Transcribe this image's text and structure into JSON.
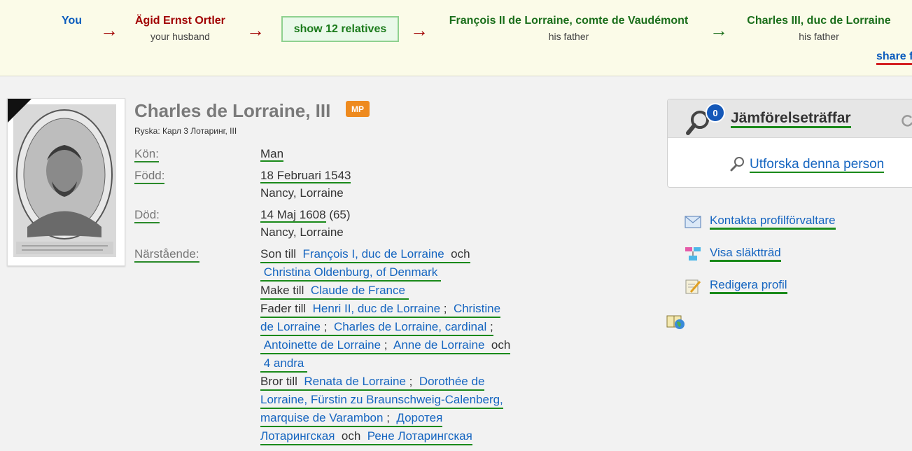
{
  "path": {
    "you": "You",
    "node1": {
      "name": "Ägid Ernst Ortler",
      "relation": "your husband"
    },
    "show_relatives": "show 12 relatives",
    "node2": {
      "name": "François II de Lorraine, comte de Vaudémont",
      "relation": "his father"
    },
    "node3": {
      "name": "Charles III, duc de Lorraine",
      "relation": "his father"
    },
    "share": "share f",
    "arrow": "→"
  },
  "profile": {
    "name": "Charles de Lorraine, III",
    "badge": "MP",
    "alt_name": "Ryska: Карл 3 Лотаринг, III",
    "gender_label": "Kön:",
    "gender": "Man",
    "born_label": "Född:",
    "born_date": "18 Februari 1543",
    "born_place": "Nancy, Lorraine",
    "died_label": "Död:",
    "died_date": "14 Maj 1608",
    "died_age": "(65)",
    "died_place": "Nancy, Lorraine",
    "relatives_label": "Närstående:",
    "son_of": "Son till",
    "father": "François I, duc de Lorraine",
    "and": "och",
    "mother": "Christina Oldenburg, of Denmark",
    "spouse_of": "Make till",
    "spouse": "Claude de France",
    "father_of": "Fader till",
    "children": [
      "Henri II, duc de Lorraine",
      "Christine",
      "de Lorraine",
      "Charles de Lorraine, cardinal",
      "Antoinette de Lorraine",
      "Anne de Lorraine",
      "4 andra"
    ],
    "brother_of": "Bror till",
    "siblings": [
      "Renata de Lorraine",
      "Dorothée de",
      "Lorraine, Fürstin zu Braunschweig-Calenberg,",
      "marquise de Varambon",
      "Доротея",
      "Лотарингская",
      "Рене Лотарингская"
    ],
    "sep": ";"
  },
  "panel": {
    "match_count": "0",
    "match_title": "Jämförelseträffar",
    "explore": "Utforska denna person",
    "actions": [
      "Kontakta profilförvaltare",
      "Visa släktträd",
      "Redigera profil"
    ]
  },
  "colors": {
    "you": "#0a5bbd",
    "husband": "#a00000",
    "ancestor": "#1a6e1a",
    "link": "#1565c0",
    "underline": "#1a8a1a"
  }
}
